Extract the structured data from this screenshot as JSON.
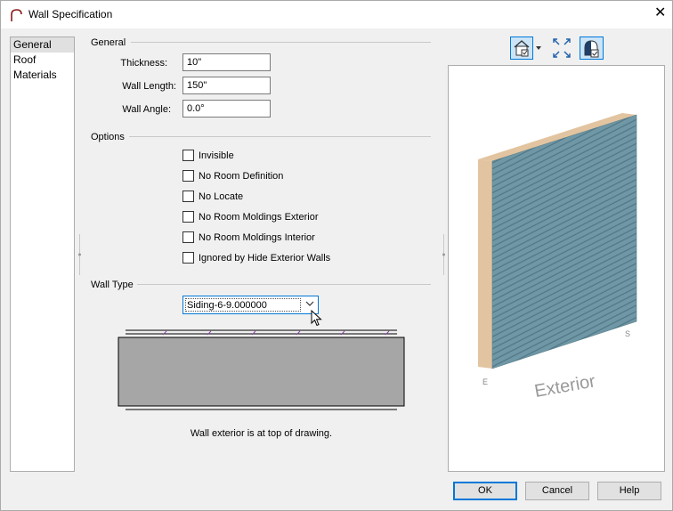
{
  "window": {
    "title": "Wall Specification"
  },
  "nav": {
    "items": [
      "General",
      "Roof",
      "Materials"
    ]
  },
  "general": {
    "group_label": "General",
    "thickness_label": "Thickness:",
    "thickness_value": "10\"",
    "length_label": "Wall Length:",
    "length_value": "150\"",
    "angle_label": "Wall Angle:",
    "angle_value": "0.0°"
  },
  "options": {
    "group_label": "Options",
    "checkboxes": [
      {
        "label": "Invisible",
        "checked": false
      },
      {
        "label": "No Room Definition",
        "checked": false
      },
      {
        "label": "No Locate",
        "checked": false
      },
      {
        "label": "No Room Moldings Exterior",
        "checked": false
      },
      {
        "label": "No Room Moldings Interior",
        "checked": false
      },
      {
        "label": "Ignored by Hide Exterior Walls",
        "checked": false
      }
    ]
  },
  "wall_type": {
    "group_label": "Wall Type",
    "selected": "Siding-6-9.000000",
    "caption": "Wall exterior is at top of drawing."
  },
  "preview": {
    "exterior_label": "Exterior",
    "compass_e": "E",
    "compass_s": "S"
  },
  "buttons": {
    "ok": "OK",
    "cancel": "Cancel",
    "help": "Help"
  },
  "colors": {
    "accent": "#0078d7",
    "siding": "#6f97a5",
    "wall_edge": "#e2c4a0",
    "layer_fill": "#a6a6a6"
  }
}
